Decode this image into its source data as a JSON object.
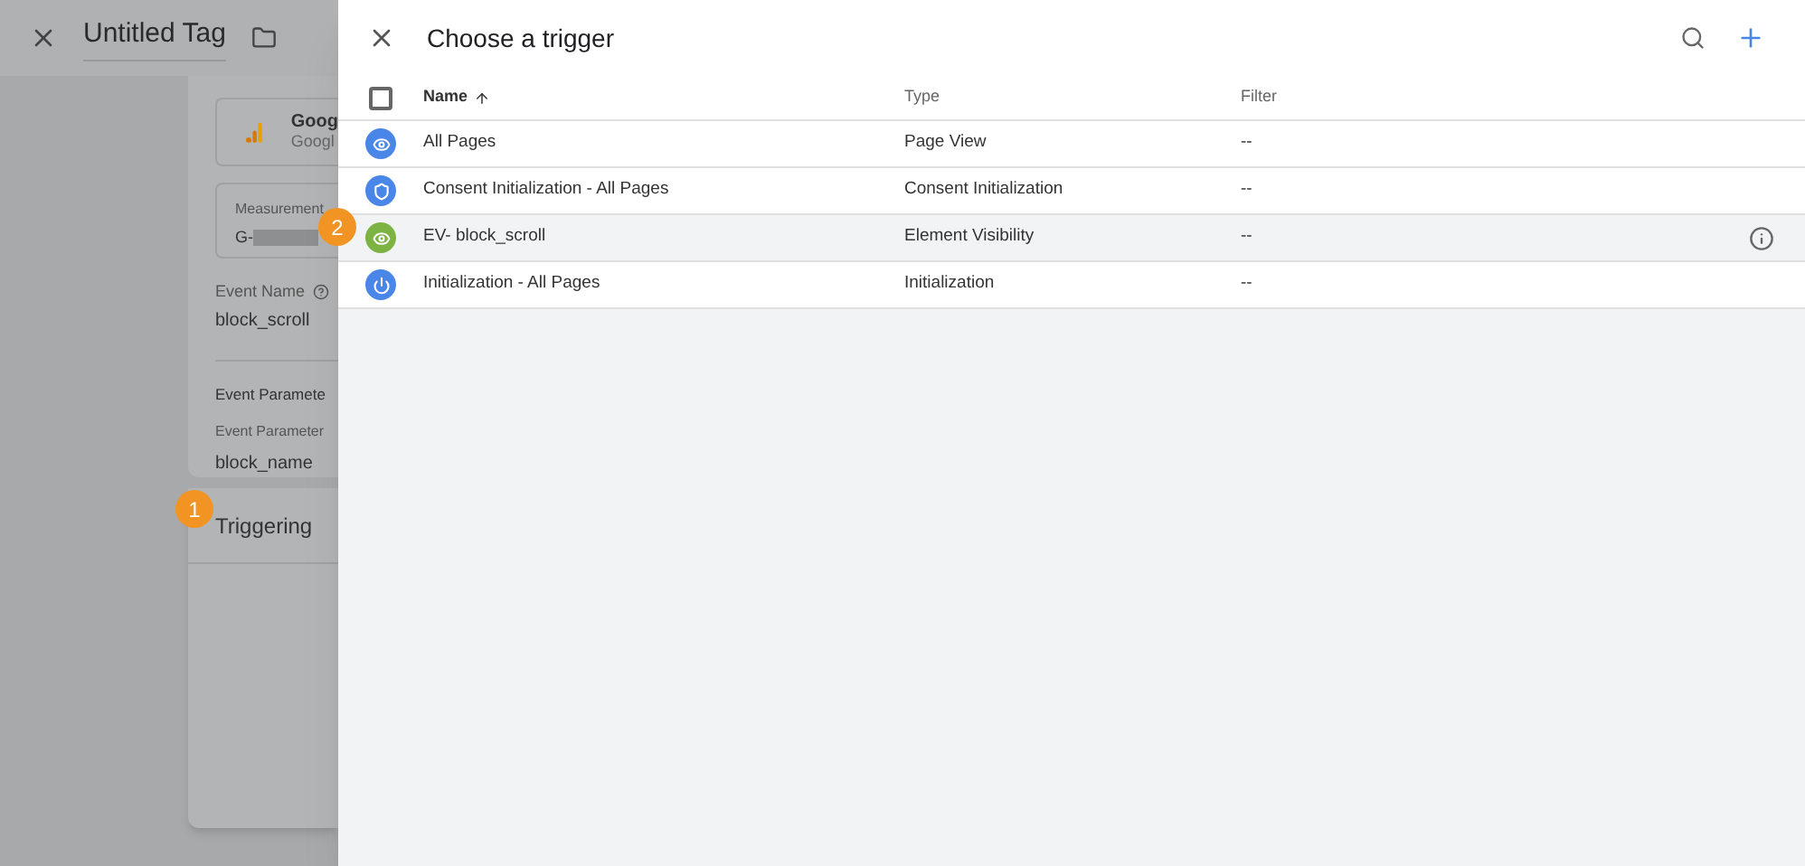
{
  "tag_editor": {
    "title": "Untitled Tag",
    "tag_type": {
      "name": "Goog",
      "subtitle": "Googl"
    },
    "measurement": {
      "label": "Measurement",
      "value": "G-"
    },
    "event_name": {
      "label": "Event Name",
      "value": "block_scroll"
    },
    "event_parameters": {
      "heading": "Event Paramete",
      "label": "Event Parameter",
      "value": "block_name"
    },
    "triggering": {
      "heading": "Triggering"
    }
  },
  "badges": [
    "1",
    "2"
  ],
  "trigger_panel": {
    "title": "Choose a trigger",
    "columns": [
      "Name",
      "Type",
      "Filter"
    ],
    "select_all": {
      "checked": false
    },
    "rows": [
      {
        "name": "All Pages",
        "type": "Page View",
        "filter": "--",
        "kind": "view",
        "color": "#4a86e8",
        "selected": false
      },
      {
        "name": "Consent Initialization - All Pages",
        "type": "Consent Initialization",
        "filter": "--",
        "kind": "shield",
        "color": "#4a86e8",
        "selected": false
      },
      {
        "name": "EV- block_scroll",
        "type": "Element Visibility",
        "filter": "--",
        "kind": "view",
        "color": "#7cb342",
        "selected": true
      },
      {
        "name": "Initialization - All Pages",
        "type": "Initialization",
        "filter": "--",
        "kind": "power",
        "color": "#4a86e8",
        "selected": false
      }
    ]
  }
}
